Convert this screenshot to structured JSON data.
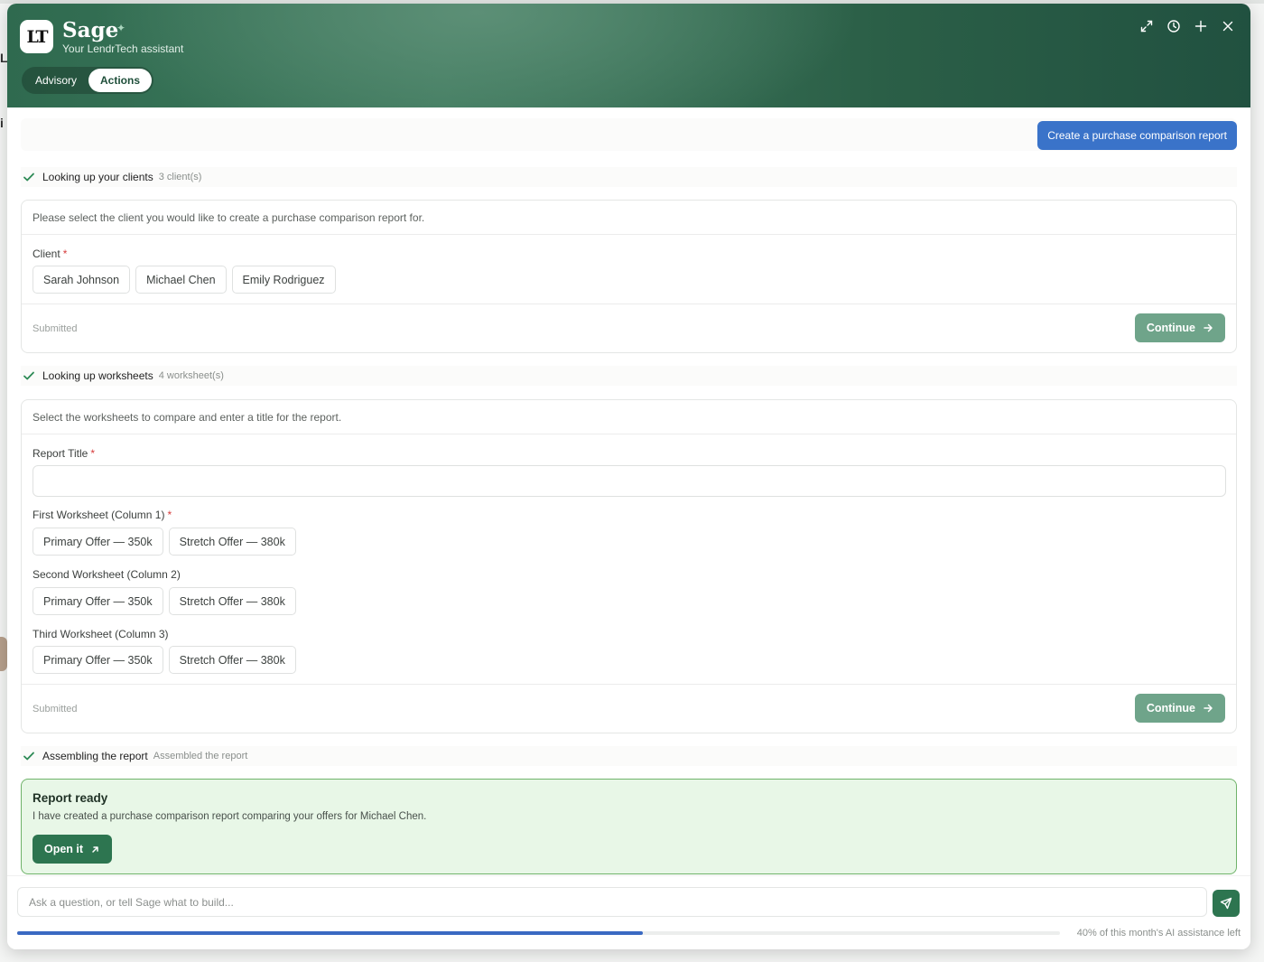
{
  "header": {
    "logo_text": "LT",
    "title": "Sage",
    "subtitle": "Your LendrTech assistant",
    "icons": [
      "expand-icon",
      "history-icon",
      "plus-icon",
      "close-icon"
    ],
    "mode_tabs": [
      {
        "label": "Advisory",
        "active": false
      },
      {
        "label": "Actions",
        "active": true
      }
    ]
  },
  "conversation": {
    "user_message": "Create a purchase comparison report",
    "step1": {
      "label": "Looking up your clients",
      "meta": "3 client(s)"
    },
    "client_card": {
      "prompt": "Please select the client you would like to create a purchase comparison report for.",
      "field_label": "Client",
      "options": [
        "Sarah Johnson",
        "Michael Chen",
        "Emily Rodriguez"
      ],
      "status": "Submitted",
      "continue_label": "Continue"
    },
    "step2": {
      "label": "Looking up worksheets",
      "meta": "4 worksheet(s)"
    },
    "worksheet_card": {
      "prompt": "Select the worksheets to compare and enter a title for the report.",
      "title_label": "Report Title",
      "title_value": "",
      "first_label": "First Worksheet (Column 1)",
      "second_label": "Second Worksheet (Column 2)",
      "third_label": "Third Worksheet (Column 3)",
      "options": [
        "Primary Offer — 350k",
        "Stretch Offer — 380k"
      ],
      "status": "Submitted",
      "continue_label": "Continue"
    },
    "step3": {
      "label": "Assembling the report",
      "meta": "Assembled the report"
    },
    "report": {
      "title": "Report ready",
      "text": "I have created a purchase comparison report comparing your offers for Michael Chen.",
      "open_label": "Open it"
    }
  },
  "composer": {
    "placeholder": "Ask a question, or tell Sage what to build...",
    "usage_text": "40% of this month's AI assistance left",
    "usage_fraction": 0.6
  },
  "colors": {
    "header_green": "#2f6a4f",
    "primary_blue": "#3a73c9",
    "continue_green": "#6fa48a",
    "action_green": "#2d7550",
    "success_bg": "#e8f7e7",
    "success_border": "#6fb36a"
  }
}
